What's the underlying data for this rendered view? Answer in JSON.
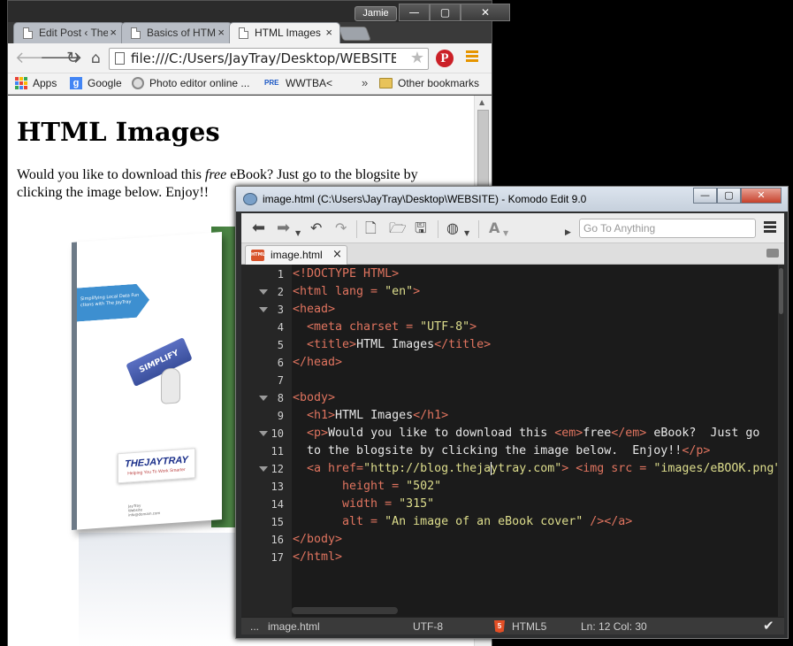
{
  "chrome": {
    "user": "Jamie",
    "window_buttons": [
      "—",
      "▢",
      "✕"
    ],
    "tabs": [
      {
        "label": "Edit Post ‹ The",
        "close": "×"
      },
      {
        "label": "Basics of HTM",
        "close": "×"
      },
      {
        "label": "HTML Images",
        "close": "×"
      }
    ],
    "address": "file:///C:/Users/JayTray/Desktop/WEBSITE/",
    "bookmarks": [
      {
        "label": "Apps"
      },
      {
        "label": "Google"
      },
      {
        "label": "Photo editor online ..."
      },
      {
        "label": "WWTBA<"
      }
    ],
    "bookmark_overflow": "»",
    "other_bookmarks": "Other bookmarks",
    "pinterest_letter": "P",
    "page": {
      "heading": "HTML Images",
      "text_before": "Would you like to download this ",
      "text_em": "free",
      "text_after": " eBook? Just go to the blogsite by clicking the image below. Enjoy!!",
      "cover_banner": "Simplifying Local Data Fun ctions with The JayTray",
      "cover_button": "SIMPLIFY",
      "cover_logo": "THEJAYTRAY",
      "cover_logo_tag": "Helping You To Work Smarter",
      "cover_footer": "JayTray\nWebsite\ninfo@domain.com"
    }
  },
  "komodo": {
    "title": "image.html (C:\\Users\\JayTray\\Desktop\\WEBSITE) - Komodo Edit 9.0",
    "window_buttons": [
      "—",
      "▢",
      "✕"
    ],
    "goto_placeholder": "Go To Anything",
    "tab": {
      "label": "image.html",
      "close": "×",
      "icon_text": "HTML"
    },
    "code_lines": [
      {
        "n": "1",
        "fold": false
      },
      {
        "n": "2",
        "fold": true
      },
      {
        "n": "3",
        "fold": true
      },
      {
        "n": "4",
        "fold": false
      },
      {
        "n": "5",
        "fold": false
      },
      {
        "n": "6",
        "fold": false
      },
      {
        "n": "7",
        "fold": false
      },
      {
        "n": "8",
        "fold": true
      },
      {
        "n": "9",
        "fold": false
      },
      {
        "n": "10",
        "fold": true
      },
      {
        "n": "11",
        "fold": false
      },
      {
        "n": "12",
        "fold": true
      },
      {
        "n": "13",
        "fold": false
      },
      {
        "n": "14",
        "fold": false
      },
      {
        "n": "15",
        "fold": false
      },
      {
        "n": "16",
        "fold": false
      },
      {
        "n": "17",
        "fold": false
      }
    ],
    "code": {
      "l1": "<!DOCTYPE HTML>",
      "l2a": "<html lang = ",
      "l2b": "\"en\"",
      "l2c": ">",
      "l3": "<head>",
      "l4a": "  <meta charset = ",
      "l4b": "\"UTF-8\"",
      "l4c": ">",
      "l5a": "  <title>",
      "l5b": "HTML Images",
      "l5c": "</title>",
      "l6": "</head>",
      "l8": "<body>",
      "l9a": "  <h1>",
      "l9b": "HTML Images",
      "l9c": "</h1>",
      "l10a": "  <p>",
      "l10b": "Would you like to download this ",
      "l10c": "<em>",
      "l10d": "free",
      "l10e": "</em>",
      "l10f": " eBook?  Just go",
      "l11a": "  to the blogsite by clicking the image below.  Enjoy!!",
      "l11b": "</p>",
      "l12a": "  <a href=",
      "l12b": "\"http://blog.theja",
      "l12c": "ytray.com\"",
      "l12d": "> <img src = ",
      "l12e": "\"images/eBOOK.png\"",
      "l13a": "       height = ",
      "l13b": "\"502\"",
      "l14a": "       width = ",
      "l14b": "\"315\"",
      "l15a": "       alt = ",
      "l15b": "\"An image of an eBook cover\"",
      "l15c": " /></a>",
      "l16": "</body>",
      "l17": "</html>"
    },
    "status": {
      "ellipsis": "...",
      "file": "image.html",
      "encoding": "UTF-8",
      "language": "HTML5",
      "position": "Ln: 12 Col: 30"
    }
  },
  "colors": {
    "tag": "#e0745f",
    "string": "#dddd8c",
    "pinterest": "#cb2027",
    "menu_orange": "#e69500"
  }
}
